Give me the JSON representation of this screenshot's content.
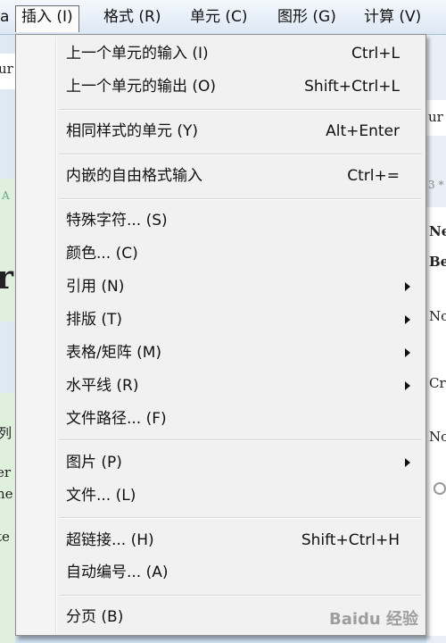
{
  "menubar": {
    "items": [
      {
        "label": "插入 (I)"
      },
      {
        "label": "格式 (R)"
      },
      {
        "label": "单元 (C)"
      },
      {
        "label": "图形 (G)"
      },
      {
        "label": "计算 (V)"
      }
    ]
  },
  "menu": {
    "items": [
      {
        "label": "上一个单元的输入 (I)",
        "shortcut": "Ctrl+L"
      },
      {
        "label": "上一个单元的输出 (O)",
        "shortcut": "Shift+Ctrl+L"
      },
      {
        "label": "相同样式的单元 (Y)",
        "shortcut": "Alt+Enter"
      },
      {
        "label": "内嵌的自由格式输入",
        "shortcut": "Ctrl+="
      },
      {
        "label": "特殊字符... (S)"
      },
      {
        "label": "颜色... (C)"
      },
      {
        "label": "引用 (N)"
      },
      {
        "label": "排版 (T)"
      },
      {
        "label": "表格/矩阵 (M)"
      },
      {
        "label": "水平线 (R)"
      },
      {
        "label": "文件路径... (F)"
      },
      {
        "label": "图片 (P)"
      },
      {
        "label": "文件... (L)"
      },
      {
        "label": "超链接... (H)",
        "shortcut": "Shift+Ctrl+H"
      },
      {
        "label": "自动编号... (A)"
      },
      {
        "label": "分页 (B)"
      }
    ]
  },
  "background": {
    "left_fragments": [
      "A",
      "r",
      "列",
      "er",
      "he",
      "te",
      "ur"
    ],
    "right_fragments": [
      "3 *",
      "Ne",
      "Be",
      "No",
      "Cr",
      "No",
      "ur"
    ]
  },
  "watermark": {
    "text": "Baidu 经验"
  }
}
